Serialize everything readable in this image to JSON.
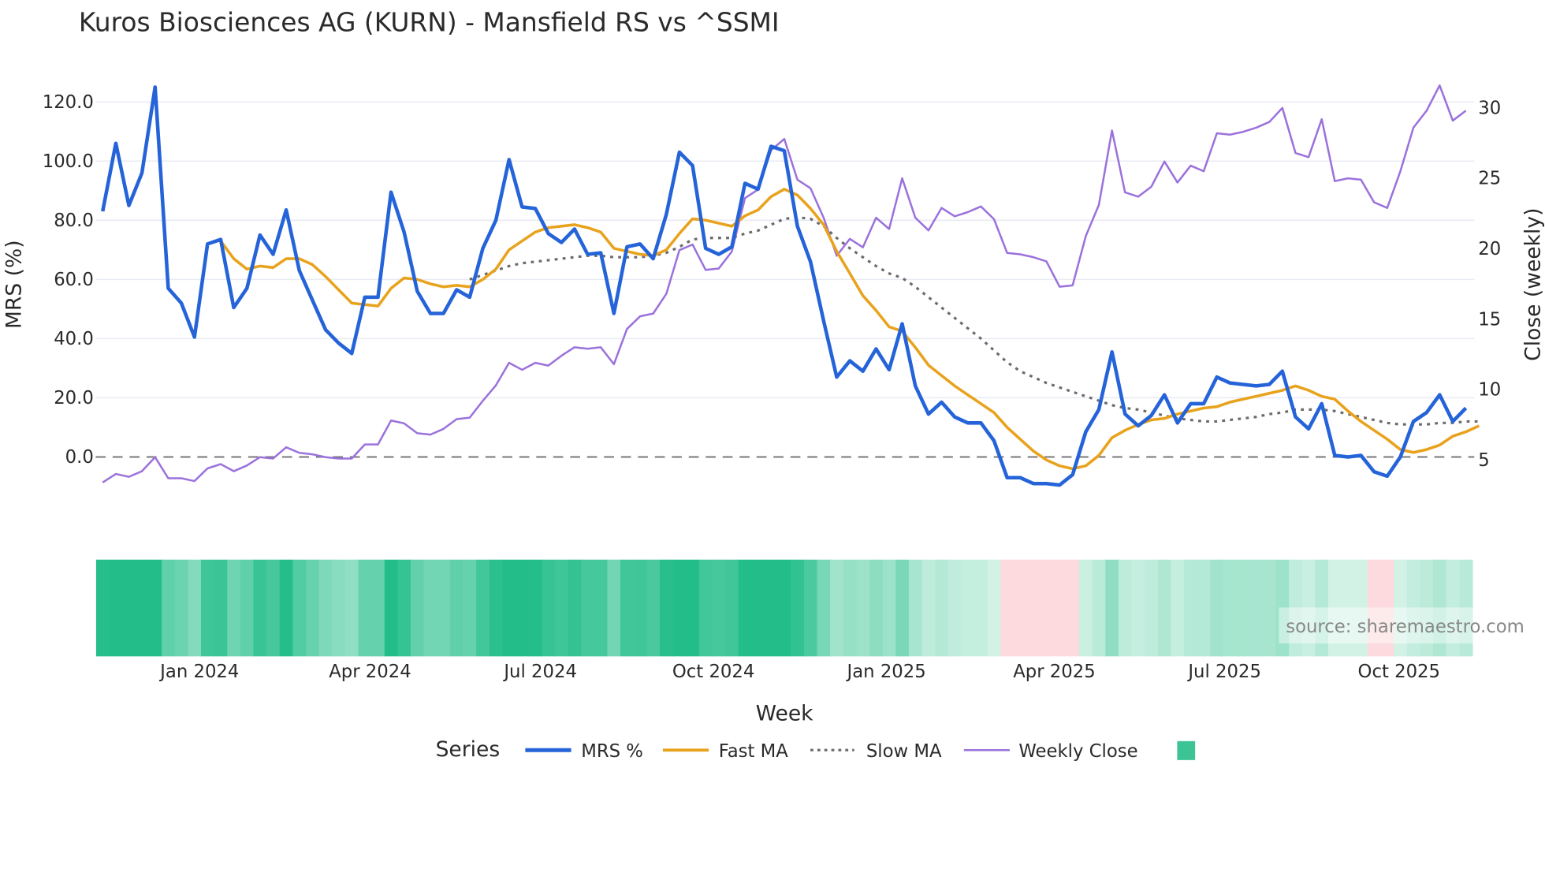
{
  "chart_data": {
    "type": "line",
    "title": "Kuros Biosciences AG (KURN) - Mansfield RS vs ^SSMI",
    "xlabel": "Week",
    "ylabel": "MRS (%)",
    "y2label": "Close (weekly)",
    "ylim": [
      -14,
      128
    ],
    "y2lim": [
      2.2,
      32.2
    ],
    "yticks": [
      "0.0",
      "20.0",
      "40.0",
      "60.0",
      "80.0",
      "100.0",
      "120.0"
    ],
    "y2ticks": [
      "5",
      "10",
      "15",
      "20",
      "25",
      "30"
    ],
    "x_ticks": [
      {
        "label": "Jan 2024",
        "week": 7.4
      },
      {
        "label": "Apr 2024",
        "week": 20.4
      },
      {
        "label": "Jul 2024",
        "week": 33.4
      },
      {
        "label": "Oct 2024",
        "week": 46.6
      },
      {
        "label": "Jan 2025",
        "week": 59.8
      },
      {
        "label": "Apr 2025",
        "week": 72.6
      },
      {
        "label": "Jul 2025",
        "week": 85.6
      },
      {
        "label": "Oct 2025",
        "week": 98.9
      }
    ],
    "grid": true,
    "zero_line": 0,
    "legend_title": "Series",
    "legend_position": "bottom",
    "source": "source: sharemaestro.com",
    "colors": {
      "mrs": "#2563d9",
      "fast": "#e8a21c",
      "slow": "#6b6b6b",
      "close": "#9b72dc",
      "heat_pos_dark": "#22bd89",
      "heat_pos_light": "#d2f2e6",
      "heat_neg": "#fcdadd"
    },
    "series": [
      {
        "name": "MRS %",
        "key": "mrs",
        "start": 0,
        "values": [
          83,
          106,
          85,
          96,
          125,
          57,
          52,
          40.5,
          72,
          73.5,
          50.5,
          57,
          75,
          68.5,
          83.5,
          63,
          53,
          43,
          38.5,
          35,
          54,
          54,
          89.5,
          76,
          56,
          48.5,
          48.5,
          56.5,
          54,
          70.5,
          80,
          100.5,
          84.5,
          84,
          75.5,
          72.5,
          77,
          68.5,
          69,
          48.5,
          71,
          72,
          67,
          82,
          103,
          98.5,
          70.5,
          68.5,
          71,
          92.5,
          90.5,
          105,
          103.5,
          78,
          66,
          46,
          27,
          32.5,
          29,
          36.5,
          29.5,
          45,
          24,
          14.5,
          18.5,
          13.5,
          11.5,
          11.5,
          5.5,
          -7,
          -7,
          -9,
          -9,
          -9.5,
          -6,
          8.5,
          16,
          35.5,
          14.5,
          10.5,
          14,
          21,
          11.5,
          18,
          18,
          27,
          25,
          24.5,
          24,
          24.5,
          29,
          13.5,
          9.5,
          18,
          0.5,
          0,
          0.5,
          -5,
          -6.5,
          0,
          12,
          15,
          21,
          12,
          16.5
        ]
      },
      {
        "name": "Fast MA",
        "key": "fast",
        "start": 9,
        "values": [
          73,
          67,
          63.5,
          64.5,
          64,
          67,
          67,
          65,
          61,
          56.5,
          52,
          51.5,
          51,
          57,
          60.5,
          60,
          58.5,
          57.5,
          58,
          57.5,
          60,
          63.5,
          70,
          73,
          76,
          77.5,
          78,
          78.5,
          77.5,
          76,
          70.5,
          69.5,
          68.5,
          68,
          70,
          75.5,
          80.5,
          80,
          79,
          78,
          81.5,
          83.5,
          88,
          90.5,
          88.5,
          84,
          78.5,
          69.5,
          62,
          54.5,
          49.5,
          44,
          42.5,
          37,
          31,
          27.5,
          24,
          21,
          18,
          15,
          10,
          6,
          2,
          -1,
          -3,
          -4,
          -3,
          0.5,
          6.5,
          9,
          11,
          12.5,
          13,
          14.5,
          15.5,
          16.5,
          17,
          18.5,
          19.5,
          20.5,
          21.5,
          22.5,
          24,
          22.5,
          20.5,
          19.5,
          15.5,
          12,
          9,
          6,
          2.5,
          1.5,
          2.5,
          4,
          7,
          8.5,
          10.5
        ]
      },
      {
        "name": "Slow MA",
        "key": "slow",
        "start": 28,
        "values": [
          60,
          61.5,
          63,
          64.5,
          65.5,
          66,
          66.5,
          67,
          67.5,
          68,
          68,
          67.5,
          67.5,
          67.5,
          68,
          69,
          71,
          73.5,
          74,
          74,
          74,
          75.5,
          76.5,
          78.5,
          80.5,
          81,
          80.5,
          78,
          74,
          70.5,
          67.5,
          64.5,
          62,
          60.5,
          57.5,
          54,
          50.5,
          47,
          43.5,
          40,
          36,
          32,
          29,
          27,
          25,
          23.5,
          22,
          20.5,
          19,
          17.5,
          16.5,
          16,
          15,
          14,
          13,
          12.5,
          12,
          12,
          12.5,
          13,
          13.5,
          14.5,
          15,
          16,
          16,
          16,
          15.5,
          14.5,
          13.5,
          12.5,
          11.5,
          11,
          11,
          11,
          11.5,
          11.5,
          12,
          12
        ]
      },
      {
        "name": "Weekly Close",
        "key": "close",
        "axis": "right",
        "start": 0,
        "values": [
          3.4,
          4.0,
          3.8,
          4.2,
          5.2,
          3.7,
          3.7,
          3.5,
          4.4,
          4.7,
          4.2,
          4.6,
          5.2,
          5.1,
          5.9,
          5.5,
          5.4,
          5.2,
          5.1,
          5.1,
          6.1,
          6.1,
          7.8,
          7.6,
          6.9,
          6.8,
          7.2,
          7.9,
          8.0,
          9.2,
          10.3,
          11.9,
          11.4,
          11.9,
          11.7,
          12.4,
          13.0,
          12.9,
          13.0,
          11.8,
          14.3,
          15.2,
          15.4,
          16.8,
          19.9,
          20.3,
          18.5,
          18.6,
          19.8,
          23.6,
          24.2,
          27.0,
          27.8,
          24.9,
          24.3,
          22.2,
          19.5,
          20.7,
          20.1,
          22.2,
          21.4,
          25.0,
          22.2,
          21.3,
          22.9,
          22.3,
          22.6,
          23.0,
          22.1,
          19.7,
          19.6,
          19.4,
          19.1,
          17.3,
          17.4,
          20.9,
          23.1,
          28.4,
          24.0,
          23.7,
          24.4,
          26.2,
          24.7,
          25.9,
          25.5,
          28.2,
          28.1,
          28.3,
          28.6,
          29.0,
          30.0,
          26.8,
          26.5,
          29.2,
          24.8,
          25.0,
          24.9,
          23.3,
          22.9,
          25.5,
          28.6,
          29.8,
          31.6,
          29.1,
          29.8
        ]
      }
    ]
  }
}
